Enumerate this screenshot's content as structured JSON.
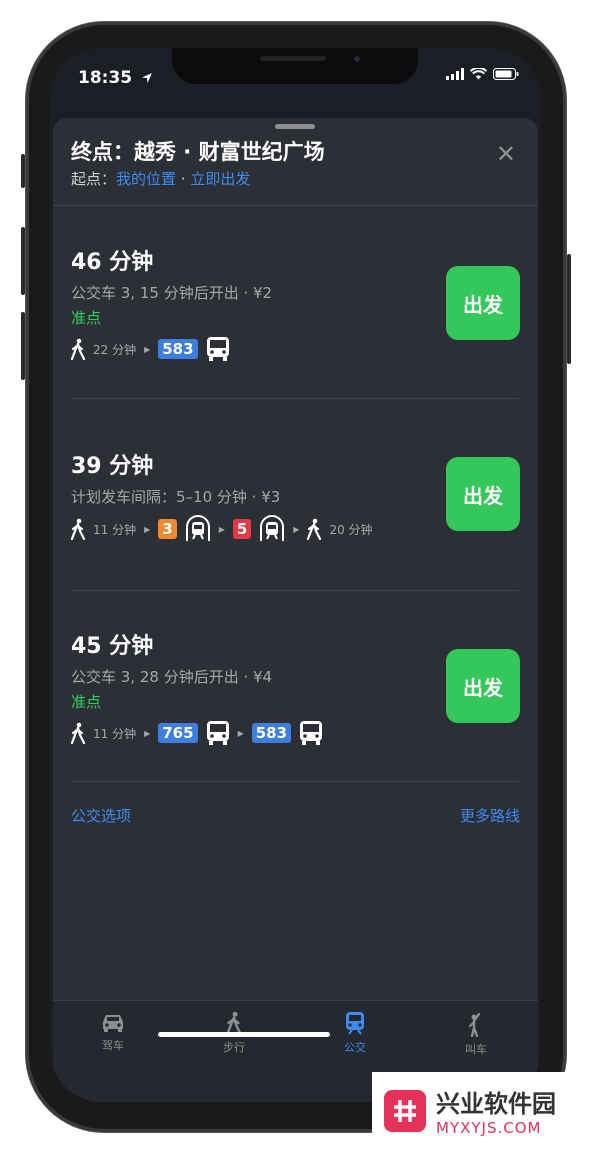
{
  "status": {
    "time": "18:35"
  },
  "header": {
    "title": "终点：越秀 · 财富世纪广场",
    "origin_label": "起点：",
    "origin_value": "我的位置",
    "separator": " · ",
    "depart_now": "立即出发"
  },
  "routes": [
    {
      "duration": "46 分钟",
      "detail": "公交车 3, 15 分钟后开出 · ¥2",
      "status": "准点",
      "walk1": "22 分钟",
      "line1": "583",
      "go": "出发"
    },
    {
      "duration": "39 分钟",
      "detail": "计划发车间隔：5–10 分钟 · ¥3",
      "walk1": "11 分钟",
      "line1": "3",
      "line2": "5",
      "walk2": "20 分钟",
      "go": "出发"
    },
    {
      "duration": "45 分钟",
      "detail": "公交车 3, 28 分钟后开出 · ¥4",
      "status": "准点",
      "walk1": "11 分钟",
      "line1": "765",
      "line2": "583",
      "go": "出发"
    }
  ],
  "footer": {
    "transit_options": "公交选项",
    "more_routes": "更多路线"
  },
  "tabs": [
    {
      "label": "驾车",
      "icon": "car-icon"
    },
    {
      "label": "步行",
      "icon": "walk-icon"
    },
    {
      "label": "公交",
      "icon": "transit-icon",
      "active": true
    },
    {
      "label": "叫车",
      "icon": "hail-icon"
    }
  ],
  "watermark": {
    "name": "兴业软件园",
    "url": "MYXYJS.COM"
  },
  "colors": {
    "accent": "#3c8cf2",
    "go": "#34c759",
    "line3": "#f0882d",
    "line5": "#e53946",
    "bus": "#3d7fe0"
  }
}
